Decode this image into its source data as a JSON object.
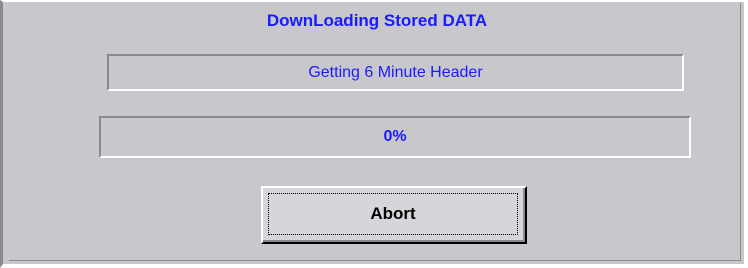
{
  "dialog": {
    "title": "DownLoading Stored DATA",
    "status_text": "Getting 6 Minute Header",
    "progress": {
      "percent": 0,
      "label": "0%"
    },
    "abort_label": "Abort"
  },
  "colors": {
    "background": "#c8c7cb",
    "accent_text": "#1a1aff",
    "shadow": "#8a8a8e",
    "highlight": "#ffffff"
  }
}
